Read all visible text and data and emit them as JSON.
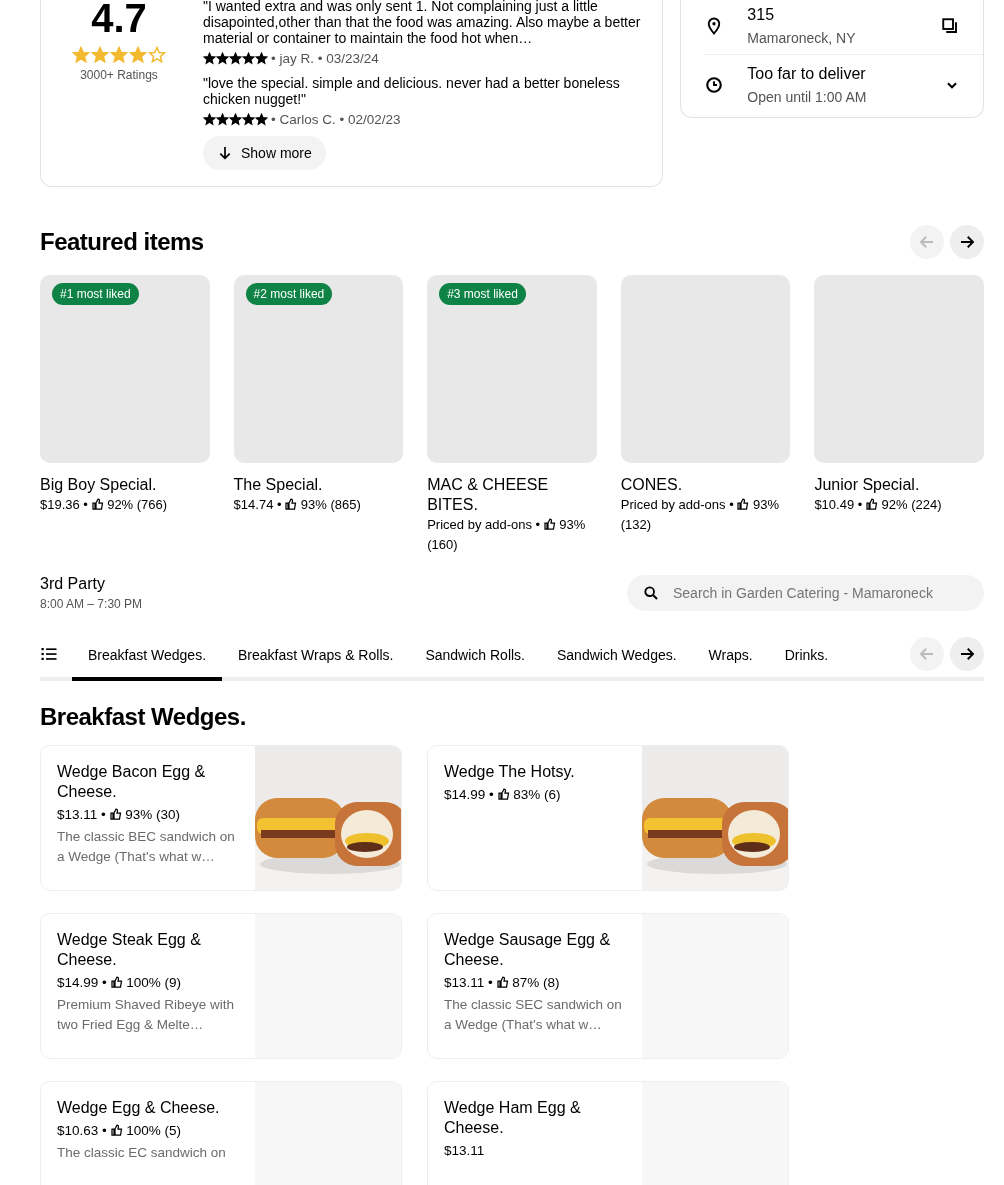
{
  "reviews_card": {
    "rating": "4.7",
    "stars": 4,
    "ratings_count": "3000+ Ratings",
    "reviews": [
      {
        "text": "\"I wanted extra and was only sent 1. Not complaining just a little disapointed,other than that the food was amazing. Also maybe a better material or container to maintain the food hot when…",
        "stars": 5,
        "meta": "• jay R. • 03/23/24"
      },
      {
        "text": "\"love the special. simple and delicious. never had a better boneless chicken nugget!\"",
        "stars": 5,
        "meta": "• Carlos C. • 02/02/23"
      }
    ],
    "show_more": "Show more"
  },
  "store_info": {
    "address": "315",
    "city": "Mamaroneck, NY",
    "delivery": "Too far to deliver",
    "hours": "Open until 1:00 AM"
  },
  "featured": {
    "title": "Featured items",
    "prev_disabled": true,
    "items": [
      {
        "badge": "#1 most liked",
        "name": "Big Boy Special.",
        "price": "$19.36 •",
        "rating": "92% (766)"
      },
      {
        "badge": "#2 most liked",
        "name": "The Special.",
        "price": "$14.74 •",
        "rating": "93% (865)"
      },
      {
        "badge": "#3 most liked",
        "name": "MAC & CHEESE BITES.",
        "price": "Priced by add-ons •",
        "rating": "93% (160)"
      },
      {
        "name": "CONES.",
        "price": "Priced by add-ons •",
        "rating": "93% (132)"
      },
      {
        "name": "Junior Special.",
        "price": "$10.49 •",
        "rating": "92% (224)"
      }
    ]
  },
  "menu": {
    "name": "3rd Party",
    "hours": "8:00 AM – 7:30 PM",
    "search": {
      "placeholder": "Search in Garden Catering - Mamaroneck"
    },
    "prev_disabled": true,
    "tabs": [
      {
        "label": "Breakfast Wedges.",
        "selected": true
      },
      {
        "label": "Breakfast Wraps & Rolls.",
        "selected": false
      },
      {
        "label": "Sandwich Rolls.",
        "selected": false
      },
      {
        "label": "Sandwich Wedges.",
        "selected": false
      },
      {
        "label": "Wraps.",
        "selected": false
      },
      {
        "label": "Drinks.",
        "selected": false
      }
    ]
  },
  "section": {
    "title": "Breakfast Wedges.",
    "items": [
      {
        "name": "Wedge Bacon Egg & Cheese.",
        "price": "$13.11 •",
        "rating": "93% (30)",
        "description": "The classic BEC sandwich on a Wedge (That's what w…"
      },
      {
        "name": "Wedge The Hotsy.",
        "price": "$14.99 •",
        "rating": "83% (6)"
      },
      {
        "name": "Wedge Steak Egg & Cheese.",
        "price": "$14.99 •",
        "rating": "100% (9)",
        "description": "Premium Shaved Ribeye with two Fried Egg & Melte…"
      },
      {
        "name": "Wedge Sausage Egg & Cheese.",
        "price": "$13.11 •",
        "rating": "87% (8)",
        "description": "The classic SEC sandwich on a Wedge (That's what w…"
      },
      {
        "name": "Wedge Egg & Cheese.",
        "price": "$10.63 •",
        "rating": "100% (5)",
        "description": "The classic EC sandwich on"
      },
      {
        "name": "Wedge Ham Egg & Cheese.",
        "price": "$13.11"
      }
    ]
  }
}
